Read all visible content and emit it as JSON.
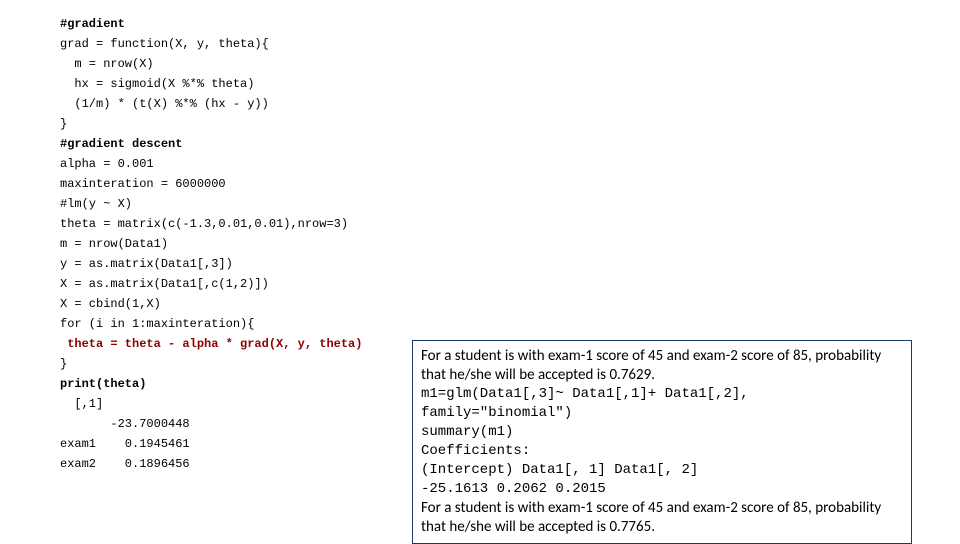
{
  "code": {
    "l1": "#gradient",
    "l2": "grad = function(X, y, theta){",
    "l3": "  m = nrow(X)",
    "l4": "  hx = sigmoid(X %*% theta)",
    "l5": "  (1/m) * (t(X) %*% (hx - y))",
    "l6": "}",
    "l7": "#gradient descent",
    "l8": "alpha = 0.001",
    "l9": "maxinteration = 6000000",
    "l10": "#lm(y ~ X)",
    "l11": "theta = matrix(c(-1.3,0.01,0.01),nrow=3)",
    "l12": "m = nrow(Data1)",
    "l13": "y = as.matrix(Data1[,3])",
    "l14": "X = as.matrix(Data1[,c(1,2)])",
    "l15": "X = cbind(1,X)",
    "l16": "for (i in 1:maxinteration){",
    "l17": " theta = theta - alpha * grad(X, y, theta)",
    "l18": "}",
    "l19": "print(theta)",
    "l20": "  [,1]",
    "l21": "       -23.7000448",
    "l22": "exam1    0.1945461",
    "l23": "exam2    0.1896456"
  },
  "annotation": {
    "p1": "For a student is with exam-1 score of 45 and exam-2 score of 85, probability that he/she will be accepted is 0.7629.",
    "p2": "m1=glm(Data1[,3]~ Data1[,1]+ Data1[,2], family=\"binomial\")",
    "p3": "summary(m1)",
    "p4": "Coefficients:",
    "p5a": "(Intercept)    Data1[, 1]    Data1[, 2]",
    "p5b": "   -25.1613        0.2062        0.2015",
    "p6": "For a student is with exam-1 score of 45 and exam-2 score of 85, probability that he/she will be accepted is 0.7765."
  }
}
